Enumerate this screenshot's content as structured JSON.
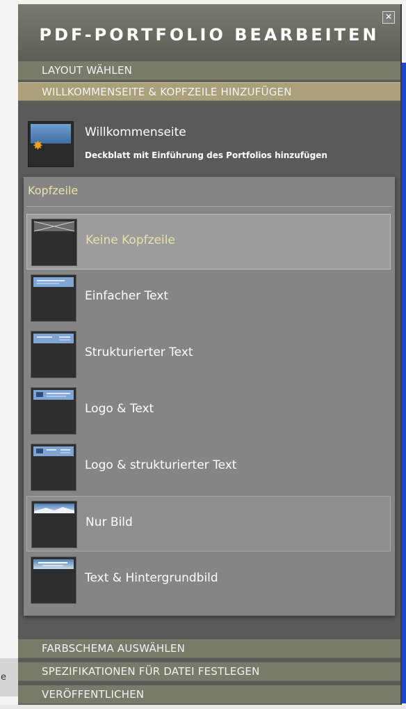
{
  "panel": {
    "title": "PDF-PORTFOLIO BEARBEITEN",
    "close_icon": "close-icon"
  },
  "sections": {
    "layout": "LAYOUT WÄHLEN",
    "welcome_header": "WILLKOMMENSEITE & KOPFZEILE HINZUFÜGEN",
    "color_scheme": "FARBSCHEMA AUSWÄHLEN",
    "file_specs": "SPEZIFIKATIONEN FÜR DATEI FESTLEGEN",
    "publish": "VERÖFFENTLICHEN"
  },
  "welcome": {
    "title": "Willkommenseite",
    "subtitle": "Deckblatt mit Einführung des Portfolios hinzufügen",
    "icon": "welcome-page-icon"
  },
  "header_options": {
    "title": "Kopfzeile",
    "selected": "Keine Kopfzeile",
    "hover": "Nur Bild",
    "items": [
      {
        "label": "Keine Kopfzeile",
        "icon": "no-header-icon"
      },
      {
        "label": "Einfacher Text",
        "icon": "simple-text-icon"
      },
      {
        "label": "Strukturierter Text",
        "icon": "structured-text-icon"
      },
      {
        "label": "Logo & Text",
        "icon": "logo-text-icon"
      },
      {
        "label": "Logo & strukturierter Text",
        "icon": "logo-structured-text-icon"
      },
      {
        "label": "Nur Bild",
        "icon": "image-only-icon"
      },
      {
        "label": "Text & Hintergrundbild",
        "icon": "text-background-image-icon"
      }
    ]
  },
  "background": {
    "left_fragment": "e"
  }
}
